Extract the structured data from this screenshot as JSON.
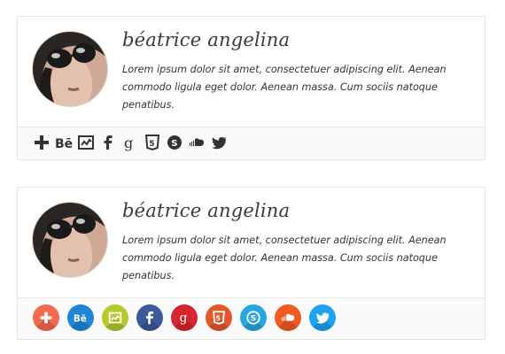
{
  "cards": [
    {
      "name": "béatrice angelina",
      "bio": "Lorem ipsum dolor sit amet, consectetuer adipiscing elit. Aenean commodo ligula eget dolor. Aenean massa. Cum sociis natoque penatibus.",
      "social_style": "plain-dark",
      "social": [
        {
          "icon": "google-plus-icon",
          "glyph": "+"
        },
        {
          "icon": "behance-icon",
          "glyph": "Bē"
        },
        {
          "icon": "slideshare-icon",
          "glyph": ""
        },
        {
          "icon": "facebook-icon",
          "glyph": "f"
        },
        {
          "icon": "google-icon",
          "glyph": "g"
        },
        {
          "icon": "html5-icon",
          "glyph": "5"
        },
        {
          "icon": "skype-icon",
          "glyph": "S"
        },
        {
          "icon": "soundcloud-icon",
          "glyph": ""
        },
        {
          "icon": "twitter-icon",
          "glyph": ""
        }
      ]
    },
    {
      "name": "béatrice angelina",
      "bio": "Lorem ipsum dolor sit amet, consectetuer adipiscing elit. Aenean commodo ligula eget dolor. Aenean massa. Cum sociis natoque penatibus.",
      "social_style": "colored-circles",
      "social": [
        {
          "icon": "google-plus-icon",
          "color": "#f26b4f",
          "glyph": "+"
        },
        {
          "icon": "behance-icon",
          "color": "#1f86d8",
          "glyph": "Bē"
        },
        {
          "icon": "slideshare-icon",
          "color": "#b6c92a",
          "glyph": ""
        },
        {
          "icon": "facebook-icon",
          "color": "#3b5a9a",
          "glyph": "f"
        },
        {
          "icon": "google-icon",
          "color": "#d7262f",
          "glyph": "g"
        },
        {
          "icon": "html5-icon",
          "color": "#e3572b",
          "glyph": "5"
        },
        {
          "icon": "skype-icon",
          "color": "#27a7df",
          "glyph": "S"
        },
        {
          "icon": "soundcloud-icon",
          "color": "#f15a22",
          "glyph": ""
        },
        {
          "icon": "twitter-icon",
          "color": "#1da1f2",
          "glyph": ""
        }
      ]
    }
  ]
}
